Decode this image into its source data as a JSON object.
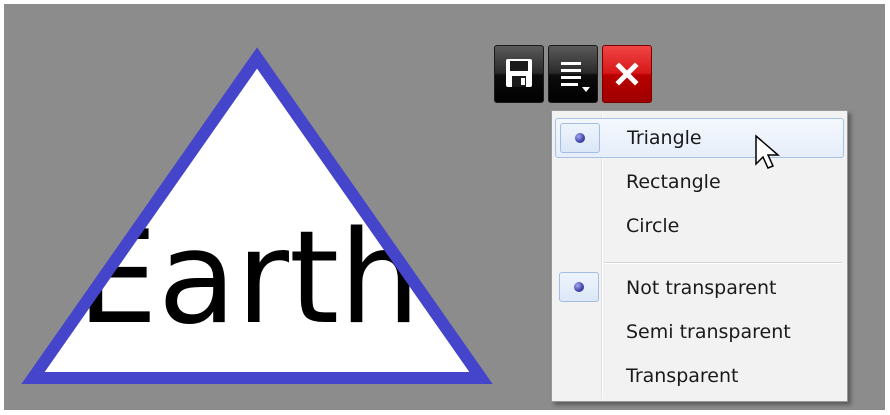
{
  "canvas": {
    "shape_label": "Earth",
    "shape_type": "triangle",
    "fill_color": "#ffffff",
    "stroke_color": "#4545cc",
    "text_color": "#000000",
    "background_color": "#8c8c8c"
  },
  "toolbar": {
    "save_icon": "floppy-disk-icon",
    "menu_icon": "menu-lines-icon",
    "close_icon": "close-x-icon"
  },
  "menu": {
    "shape_items": [
      {
        "label": "Triangle",
        "checked": true,
        "highlighted": true
      },
      {
        "label": "Rectangle",
        "checked": false,
        "highlighted": false
      },
      {
        "label": "Circle",
        "checked": false,
        "highlighted": false
      }
    ],
    "transparency_items": [
      {
        "label": "Not transparent",
        "checked": true,
        "highlighted": false
      },
      {
        "label": "Semi transparent",
        "checked": false,
        "highlighted": false
      },
      {
        "label": "Transparent",
        "checked": false,
        "highlighted": false
      }
    ]
  }
}
